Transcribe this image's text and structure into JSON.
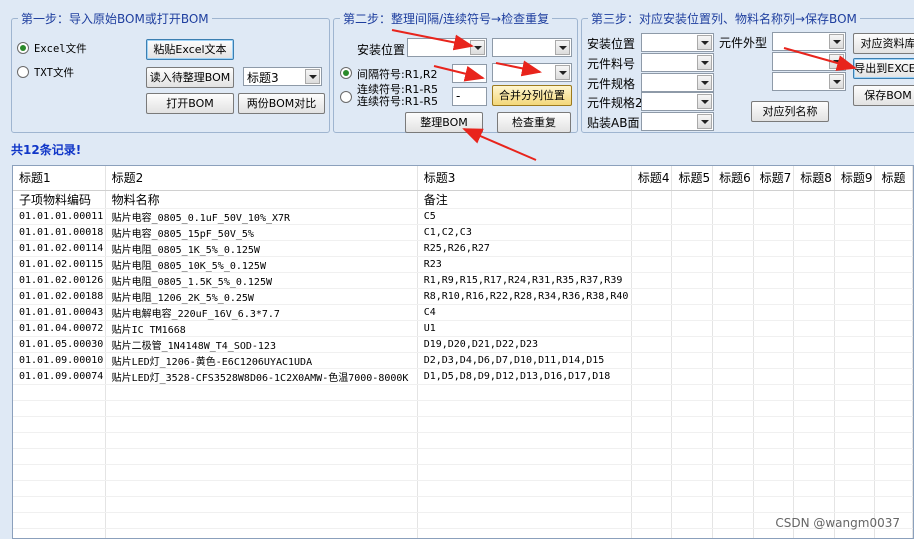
{
  "step1": {
    "legend": "第一步：导入原始BOM或打开BOM",
    "radio_excel": "Excel文件",
    "radio_txt": "TXT文件",
    "paste_excel": "粘贴Excel文本",
    "read_bom": "读入待整理BOM",
    "title_select": "标题3",
    "open_bom": "打开BOM",
    "compare_bom": "两份BOM对比"
  },
  "step2": {
    "legend": "第二步：整理间隔/连续符号→检查重复",
    "install_pos": "安装位置",
    "interval_label": "间隔符号:R1,R2",
    "continuous_label1": "连续符号:R1-R5",
    "continuous_label2": "连续符号:R1-R5",
    "dash_value": "-",
    "merge_split": "合并分列位置",
    "organize_bom": "整理BOM",
    "check_dup": "检查重复"
  },
  "step3": {
    "legend": "第三步：对应安装位置列、物料名称列→保存BOM",
    "install_pos": "安装位置",
    "part_no": "元件料号",
    "spec": "元件规格",
    "spec2": "元件规格2",
    "ab_side": "贴装AB面",
    "footprint": "元件外型",
    "match_data": "对应资料库",
    "export_excel": "导出到EXCEL",
    "save_bom": "保存BOM",
    "match_col_name": "对应列名称"
  },
  "record_count": "共12条记录!",
  "table": {
    "headers": [
      "标题1",
      "标题2",
      "标题3",
      "标题4",
      "标题5",
      "标题6",
      "标题7",
      "标题8",
      "标题9",
      "标题"
    ],
    "subheader": [
      "子项物料编码",
      "物料名称",
      "备注"
    ],
    "rows": [
      [
        "01.01.01.00011",
        "贴片电容_0805_0.1uF_50V_10%_X7R",
        "C5"
      ],
      [
        "01.01.01.00018",
        "贴片电容_0805_15pF_50V_5%",
        "C1,C2,C3"
      ],
      [
        "01.01.02.00114",
        "贴片电阻_0805_1K_5%_0.125W",
        "R25,R26,R27"
      ],
      [
        "01.01.02.00115",
        "贴片电阻_0805_10K_5%_0.125W",
        "R23"
      ],
      [
        "01.01.02.00126",
        "贴片电阻_0805_1.5K_5%_0.125W",
        "R1,R9,R15,R17,R24,R31,R35,R37,R39"
      ],
      [
        "01.01.02.00188",
        "贴片电阻_1206_2K_5%_0.25W",
        "R8,R10,R16,R22,R28,R34,R36,R38,R40"
      ],
      [
        "01.01.01.00043",
        "贴片电解电容_220uF_16V_6.3*7.7",
        "C4"
      ],
      [
        "01.01.04.00072",
        "贴片IC TM1668",
        "U1"
      ],
      [
        "01.01.05.00030",
        "贴片二极管_1N4148W_T4_SOD-123",
        "D19,D20,D21,D22,D23"
      ],
      [
        "01.01.09.00010",
        "贴片LED灯_1206-黄色-E6C1206UYAC1UDA",
        "D2,D3,D4,D6,D7,D10,D11,D14,D15"
      ],
      [
        "01.01.09.00074",
        "贴片LED灯_3528-CFS3528W8D06-1C2X0AMW-色温7000-8000K",
        "D1,D5,D8,D9,D12,D13,D16,D17,D18"
      ]
    ]
  },
  "watermark": "CSDN @wangm0037",
  "colors": {
    "background": "#dfe9f5",
    "legend": "#1f3f9f",
    "record": "#1036c8",
    "arrow": "#e8241c"
  }
}
